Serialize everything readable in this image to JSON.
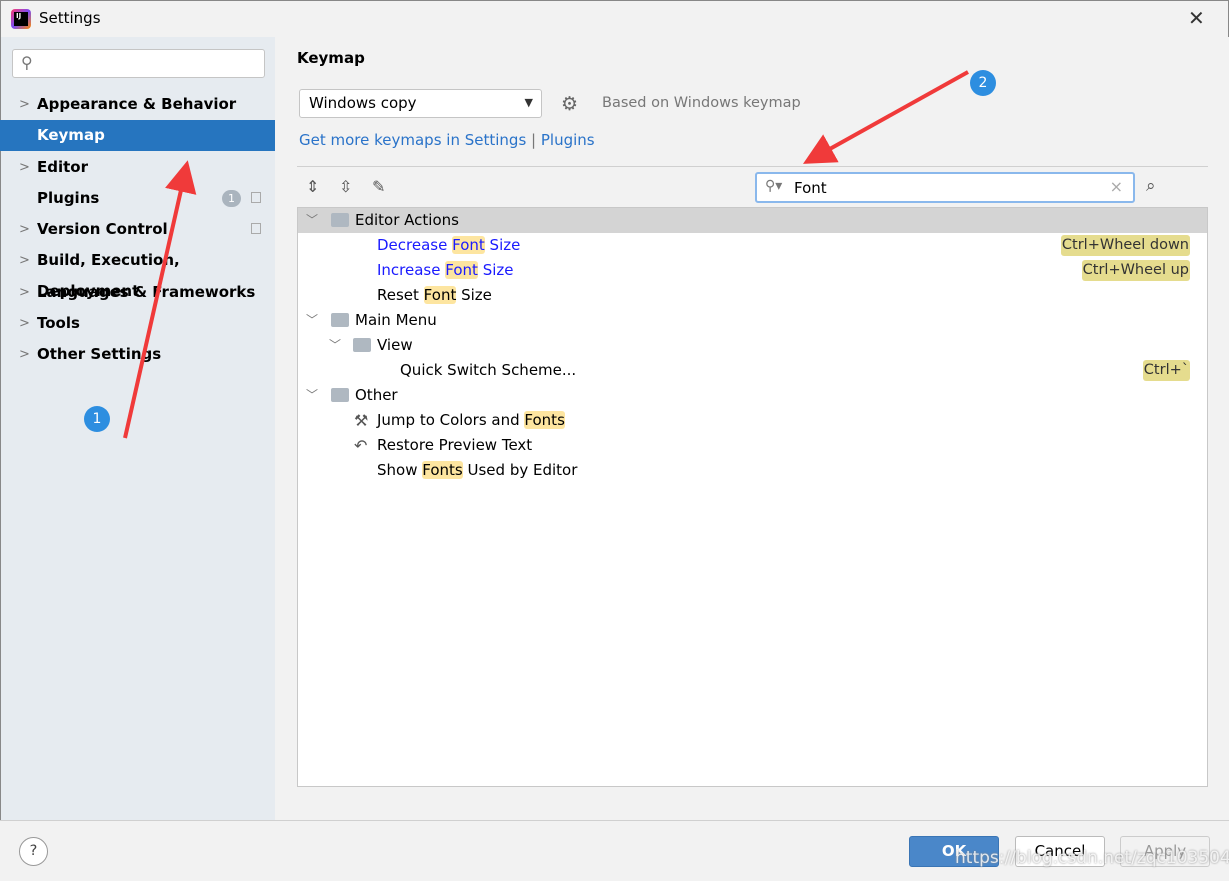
{
  "window": {
    "title": "Settings",
    "close_icon": "close-icon"
  },
  "sidebar": {
    "search_placeholder": "",
    "items": [
      {
        "label": "Appearance & Behavior",
        "expandable": true
      },
      {
        "label": "Keymap",
        "selected": true
      },
      {
        "label": "Editor",
        "expandable": true
      },
      {
        "label": "Plugins",
        "badge": "1"
      },
      {
        "label": "Version Control",
        "expandable": true
      },
      {
        "label": "Build, Execution, Deployment",
        "expandable": true
      },
      {
        "label": "Languages & Frameworks",
        "expandable": true
      },
      {
        "label": "Tools",
        "expandable": true
      },
      {
        "label": "Other Settings",
        "expandable": true
      }
    ]
  },
  "main": {
    "heading": "Keymap",
    "keymap_value": "Windows copy",
    "based_on": "Based on Windows keymap",
    "link1": "Get more keymaps in Settings",
    "link_sep": "|",
    "link2": "Plugins",
    "search_value": "Font"
  },
  "tree": [
    {
      "pre": "Editor Actions",
      "hl": "",
      "post": ""
    },
    {
      "pre": "Decrease ",
      "hl": "Font",
      "post": " Size",
      "shortcut": "Ctrl+Wheel down"
    },
    {
      "pre": "Increase ",
      "hl": "Font",
      "post": " Size",
      "shortcut": "Ctrl+Wheel up"
    },
    {
      "pre": "Reset ",
      "hl": "Font",
      "post": " Size"
    },
    {
      "pre": "Main Menu",
      "hl": "",
      "post": ""
    },
    {
      "pre": "View",
      "hl": "",
      "post": ""
    },
    {
      "pre": "Quick Switch Scheme...",
      "hl": "",
      "post": "",
      "shortcut": "Ctrl+`"
    },
    {
      "pre": "Other",
      "hl": "",
      "post": ""
    },
    {
      "pre": "Jump to Colors and ",
      "hl": "Fonts",
      "post": ""
    },
    {
      "pre": "Restore Preview Text",
      "hl": "",
      "post": ""
    },
    {
      "pre": "Show ",
      "hl": "Fonts",
      "post": " Used by Editor"
    }
  ],
  "footer": {
    "help": "?",
    "ok": "OK",
    "cancel": "Cancel",
    "apply": "Apply",
    "watermark": "https://blog.csdn.net/zqc1035049492"
  },
  "annotations": {
    "callout1": "1",
    "callout2": "2",
    "arrow_color": "#f03a3a",
    "callout_color": "#2d8ee0"
  }
}
